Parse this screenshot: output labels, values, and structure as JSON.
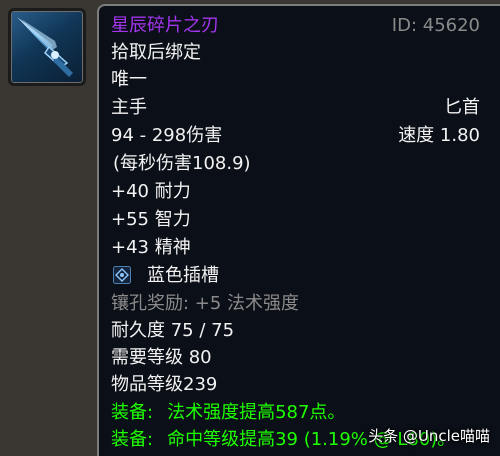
{
  "item_icon": {
    "icon": "dagger-icon"
  },
  "tooltip": {
    "name": "星辰碎片之刃",
    "id_label": "ID: 45620",
    "bind": "拾取后绑定",
    "unique": "唯一",
    "slot": "主手",
    "weapon_type": "匕首",
    "damage": "94 - 298伤害",
    "speed": "速度 1.80",
    "dps": "(每秒伤害108.9)",
    "stats": [
      "+40 耐力",
      "+55 智力",
      "+43 精神"
    ],
    "socket": {
      "icon": "blue-socket-icon",
      "label": "蓝色插槽"
    },
    "socket_bonus": "镶孔奖励: +5 法术强度",
    "durability": "耐久度 75 / 75",
    "required_level": "需要等级 80",
    "item_level": "物品等级239",
    "equip_effects": [
      {
        "prefix": "装备:",
        "text": "法术强度提高587点。"
      },
      {
        "prefix": "装备:",
        "text": "命中等级提高39 (1.19% @ L80)。"
      }
    ],
    "colors": {
      "epic": "#a335ee",
      "green": "#1eff00",
      "gray": "#8a8a8a",
      "white": "#f2f2f2"
    }
  },
  "watermark": "头条 @Uncle喵喵"
}
